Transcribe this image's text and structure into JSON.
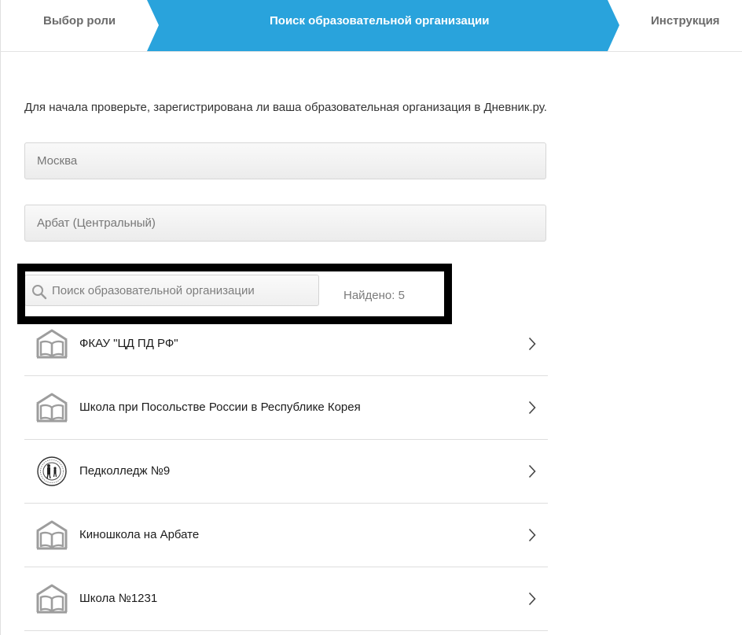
{
  "stepper": {
    "steps": [
      {
        "label": "Выбор роли"
      },
      {
        "label": "Поиск образовательной организации"
      },
      {
        "label": "Инструкция"
      }
    ],
    "active_color": "#29a3dc",
    "inactive_color": "#ffffff"
  },
  "intro_text": "Для начала проверьте, зарегистрирована ли ваша образовательная организация в Дневник.ру.",
  "city_field": {
    "value": "Москва"
  },
  "district_field": {
    "value": "Арбат (Центральный)"
  },
  "search": {
    "placeholder": "Поиск образовательной организации",
    "value": "",
    "icon": "search-icon"
  },
  "found_text": "Найдено: 5",
  "organizations": [
    {
      "name": "ФКАУ \"ЦД ПД РФ\"",
      "icon": "school-book-icon"
    },
    {
      "name": "Школа при Посольстве России в Республике Корея",
      "icon": "school-book-icon"
    },
    {
      "name": "Педколледж №9",
      "icon": "college-emblem-icon"
    },
    {
      "name": "Киношкола на Арбате",
      "icon": "school-book-icon"
    },
    {
      "name": "Школа №1231",
      "icon": "school-book-icon"
    }
  ]
}
